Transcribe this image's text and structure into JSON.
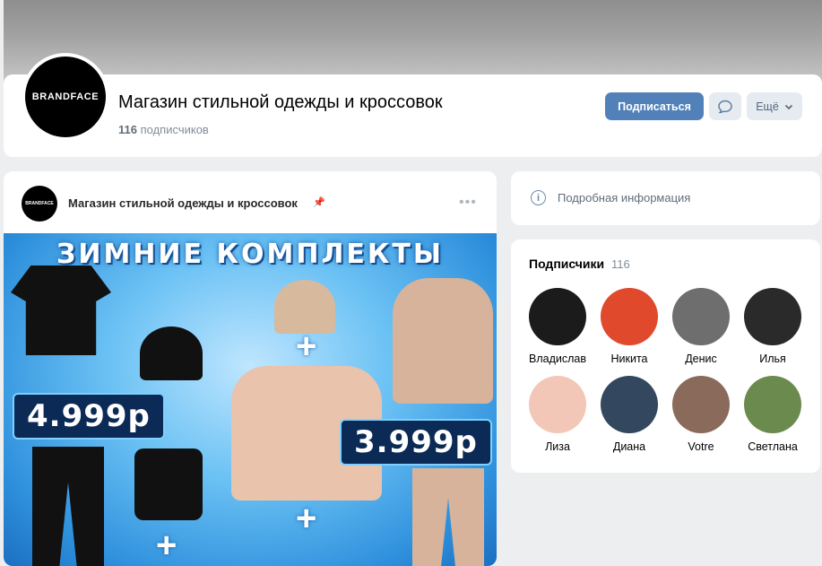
{
  "group": {
    "logo_text": "BRANDFACE",
    "title": "Магазин стильной одежды и кроссовок",
    "subscribers_count": "116",
    "subscribers_label": "подписчиков",
    "subscribe_button": "Подписаться",
    "more_button": "Ещё"
  },
  "post": {
    "author": "Магазин стильной одежды и кроссовок",
    "logo_text": "BRANDFACE",
    "menu": "•••",
    "image": {
      "title": "ЗИМНИЕ КОМПЛЕКТЫ",
      "price_left": "4.999р",
      "price_right": "3.999р"
    }
  },
  "sidebar": {
    "info_link": "Подробная информация",
    "subscribers_title": "Подписчики",
    "subscribers_count": "116",
    "subscribers": [
      {
        "name": "Владислав",
        "color": "#1b1b1b"
      },
      {
        "name": "Никита",
        "color": "#e0492c"
      },
      {
        "name": "Денис",
        "color": "#6e6e6e"
      },
      {
        "name": "Илья",
        "color": "#2a2a2a"
      },
      {
        "name": "Лиза",
        "color": "#f2c7b8"
      },
      {
        "name": "Диана",
        "color": "#33485e"
      },
      {
        "name": "Votre",
        "color": "#8a6a5a"
      },
      {
        "name": "Светлана",
        "color": "#6b8a4e"
      }
    ]
  }
}
